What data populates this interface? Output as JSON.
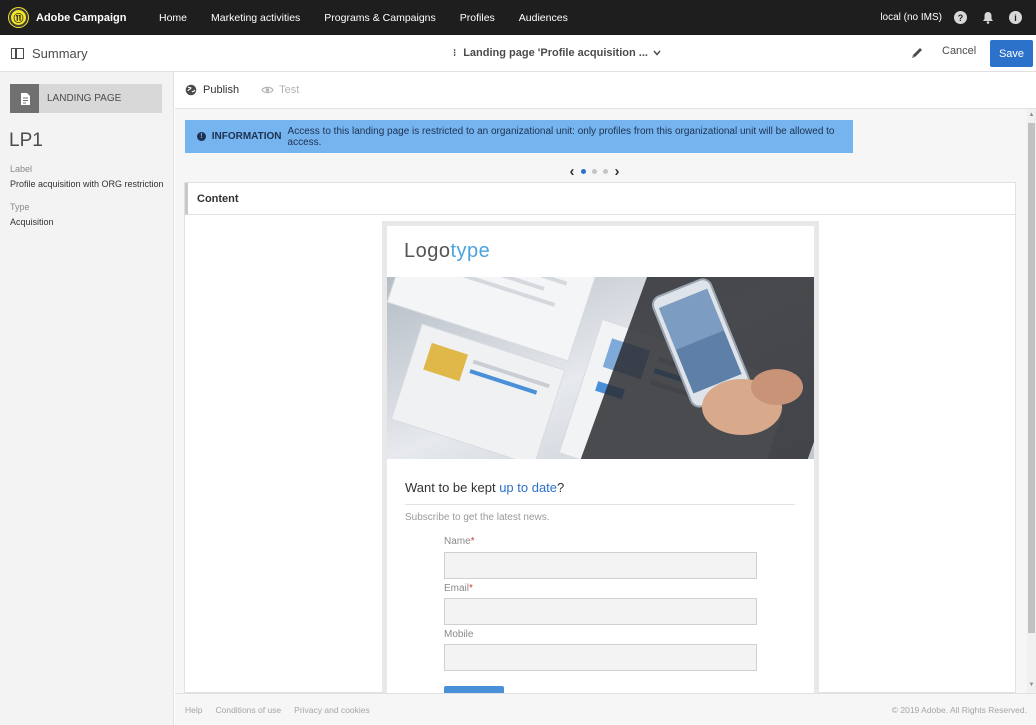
{
  "topnav": {
    "brand": "Adobe Campaign",
    "items": [
      "Home",
      "Marketing activities",
      "Programs & Campaigns",
      "Profiles",
      "Audiences"
    ],
    "environment": "local (no IMS)",
    "help_glyph": "?",
    "user_glyph": "i"
  },
  "subheader": {
    "summary_label": "Summary",
    "page_title": "Landing page 'Profile acquisition ...",
    "cancel_label": "Cancel",
    "save_label": "Save"
  },
  "left_panel": {
    "type_label": "LANDING PAGE",
    "name": "LP1",
    "label_caption": "Label",
    "label_value": "Profile acquisition with ORG restriction",
    "type_caption": "Type",
    "type_value": "Acquisition"
  },
  "toolbar": {
    "publish_label": "Publish",
    "test_label": "Test"
  },
  "info_banner": {
    "title": "INFORMATION",
    "message": "Access to this landing page is restricted to an organizational unit: only profiles from this organizational unit will be allowed to access."
  },
  "pager": {
    "pages": 3,
    "active": 1
  },
  "content": {
    "section_title": "Content"
  },
  "preview": {
    "logo_main": "Logo",
    "logo_accent": "type",
    "heading_main": "Want to be kept ",
    "heading_accent": "up to date",
    "heading_end": "?",
    "subtitle": "Subscribe to get the latest news.",
    "fields": [
      {
        "label": "Name",
        "required": true
      },
      {
        "label": "Email",
        "required": true
      },
      {
        "label": "Mobile",
        "required": false
      }
    ]
  },
  "footer": {
    "links": [
      "Help",
      "Conditions of use",
      "Privacy and cookies"
    ],
    "copyright": "© 2019 Adobe. All Rights Reserved."
  },
  "colors": {
    "topbar": "#1e1e1e",
    "primary": "#2c71ca",
    "info": "#75b4ef",
    "brand_logo": "#f4e42a",
    "logo_accent": "#4aa3df"
  }
}
